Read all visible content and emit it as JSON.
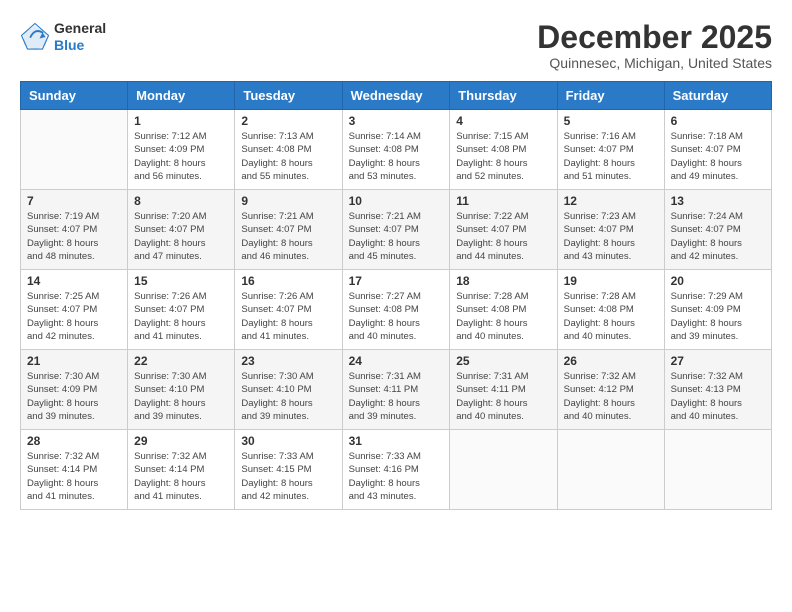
{
  "logo": {
    "general": "General",
    "blue": "Blue"
  },
  "title": "December 2025",
  "location": "Quinnesec, Michigan, United States",
  "headers": [
    "Sunday",
    "Monday",
    "Tuesday",
    "Wednesday",
    "Thursday",
    "Friday",
    "Saturday"
  ],
  "weeks": [
    [
      {
        "day": "",
        "info": ""
      },
      {
        "day": "1",
        "info": "Sunrise: 7:12 AM\nSunset: 4:09 PM\nDaylight: 8 hours\nand 56 minutes."
      },
      {
        "day": "2",
        "info": "Sunrise: 7:13 AM\nSunset: 4:08 PM\nDaylight: 8 hours\nand 55 minutes."
      },
      {
        "day": "3",
        "info": "Sunrise: 7:14 AM\nSunset: 4:08 PM\nDaylight: 8 hours\nand 53 minutes."
      },
      {
        "day": "4",
        "info": "Sunrise: 7:15 AM\nSunset: 4:08 PM\nDaylight: 8 hours\nand 52 minutes."
      },
      {
        "day": "5",
        "info": "Sunrise: 7:16 AM\nSunset: 4:07 PM\nDaylight: 8 hours\nand 51 minutes."
      },
      {
        "day": "6",
        "info": "Sunrise: 7:18 AM\nSunset: 4:07 PM\nDaylight: 8 hours\nand 49 minutes."
      }
    ],
    [
      {
        "day": "7",
        "info": "Sunrise: 7:19 AM\nSunset: 4:07 PM\nDaylight: 8 hours\nand 48 minutes."
      },
      {
        "day": "8",
        "info": "Sunrise: 7:20 AM\nSunset: 4:07 PM\nDaylight: 8 hours\nand 47 minutes."
      },
      {
        "day": "9",
        "info": "Sunrise: 7:21 AM\nSunset: 4:07 PM\nDaylight: 8 hours\nand 46 minutes."
      },
      {
        "day": "10",
        "info": "Sunrise: 7:21 AM\nSunset: 4:07 PM\nDaylight: 8 hours\nand 45 minutes."
      },
      {
        "day": "11",
        "info": "Sunrise: 7:22 AM\nSunset: 4:07 PM\nDaylight: 8 hours\nand 44 minutes."
      },
      {
        "day": "12",
        "info": "Sunrise: 7:23 AM\nSunset: 4:07 PM\nDaylight: 8 hours\nand 43 minutes."
      },
      {
        "day": "13",
        "info": "Sunrise: 7:24 AM\nSunset: 4:07 PM\nDaylight: 8 hours\nand 42 minutes."
      }
    ],
    [
      {
        "day": "14",
        "info": "Sunrise: 7:25 AM\nSunset: 4:07 PM\nDaylight: 8 hours\nand 42 minutes."
      },
      {
        "day": "15",
        "info": "Sunrise: 7:26 AM\nSunset: 4:07 PM\nDaylight: 8 hours\nand 41 minutes."
      },
      {
        "day": "16",
        "info": "Sunrise: 7:26 AM\nSunset: 4:07 PM\nDaylight: 8 hours\nand 41 minutes."
      },
      {
        "day": "17",
        "info": "Sunrise: 7:27 AM\nSunset: 4:08 PM\nDaylight: 8 hours\nand 40 minutes."
      },
      {
        "day": "18",
        "info": "Sunrise: 7:28 AM\nSunset: 4:08 PM\nDaylight: 8 hours\nand 40 minutes."
      },
      {
        "day": "19",
        "info": "Sunrise: 7:28 AM\nSunset: 4:08 PM\nDaylight: 8 hours\nand 40 minutes."
      },
      {
        "day": "20",
        "info": "Sunrise: 7:29 AM\nSunset: 4:09 PM\nDaylight: 8 hours\nand 39 minutes."
      }
    ],
    [
      {
        "day": "21",
        "info": "Sunrise: 7:30 AM\nSunset: 4:09 PM\nDaylight: 8 hours\nand 39 minutes."
      },
      {
        "day": "22",
        "info": "Sunrise: 7:30 AM\nSunset: 4:10 PM\nDaylight: 8 hours\nand 39 minutes."
      },
      {
        "day": "23",
        "info": "Sunrise: 7:30 AM\nSunset: 4:10 PM\nDaylight: 8 hours\nand 39 minutes."
      },
      {
        "day": "24",
        "info": "Sunrise: 7:31 AM\nSunset: 4:11 PM\nDaylight: 8 hours\nand 39 minutes."
      },
      {
        "day": "25",
        "info": "Sunrise: 7:31 AM\nSunset: 4:11 PM\nDaylight: 8 hours\nand 40 minutes."
      },
      {
        "day": "26",
        "info": "Sunrise: 7:32 AM\nSunset: 4:12 PM\nDaylight: 8 hours\nand 40 minutes."
      },
      {
        "day": "27",
        "info": "Sunrise: 7:32 AM\nSunset: 4:13 PM\nDaylight: 8 hours\nand 40 minutes."
      }
    ],
    [
      {
        "day": "28",
        "info": "Sunrise: 7:32 AM\nSunset: 4:14 PM\nDaylight: 8 hours\nand 41 minutes."
      },
      {
        "day": "29",
        "info": "Sunrise: 7:32 AM\nSunset: 4:14 PM\nDaylight: 8 hours\nand 41 minutes."
      },
      {
        "day": "30",
        "info": "Sunrise: 7:33 AM\nSunset: 4:15 PM\nDaylight: 8 hours\nand 42 minutes."
      },
      {
        "day": "31",
        "info": "Sunrise: 7:33 AM\nSunset: 4:16 PM\nDaylight: 8 hours\nand 43 minutes."
      },
      {
        "day": "",
        "info": ""
      },
      {
        "day": "",
        "info": ""
      },
      {
        "day": "",
        "info": ""
      }
    ]
  ]
}
